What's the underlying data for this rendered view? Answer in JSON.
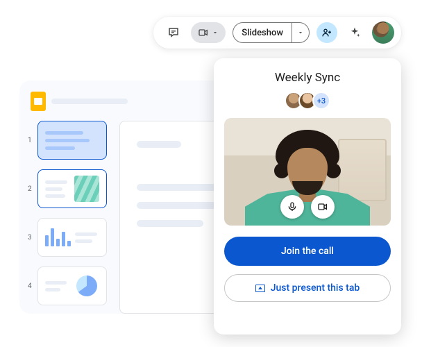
{
  "toolbar": {
    "slideshow_label": "Slideshow"
  },
  "editor": {
    "thumbs": [
      {
        "num": "1"
      },
      {
        "num": "2"
      },
      {
        "num": "3"
      },
      {
        "num": "4"
      }
    ]
  },
  "meet": {
    "title": "Weekly Sync",
    "extra_count": "+3",
    "join_label": "Join the call",
    "present_label": "Just present this tab"
  },
  "colors": {
    "accent": "#0b57d0",
    "chip_bg": "#c2e7ff"
  }
}
